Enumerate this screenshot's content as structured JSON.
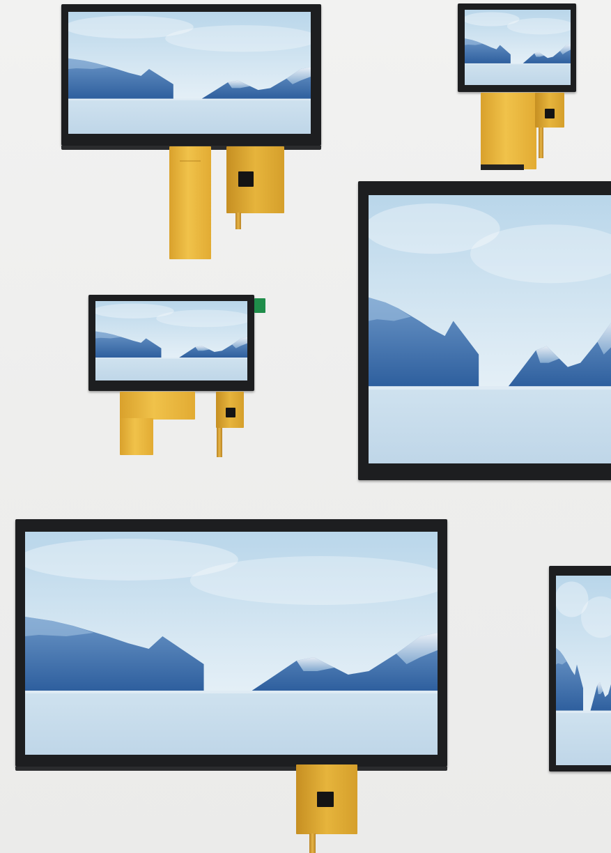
{
  "scene": {
    "subject": "lcd-touch-panels",
    "background_color": "#efefee",
    "bezel_color": "#1d1e20",
    "flex_cable_color": "#e8b53e",
    "sky_color": "#cfe4f2",
    "mountain_color": "#3f72ad",
    "floor_color": "#c9dfee"
  },
  "panels": [
    {
      "name": "panel-top-left",
      "flex_cables": 2
    },
    {
      "name": "panel-top-right-small",
      "flex_cables": 2
    },
    {
      "name": "panel-right-large",
      "flex_cables": 0
    },
    {
      "name": "panel-middle-left",
      "flex_cables": 2
    },
    {
      "name": "panel-bottom-large",
      "flex_cables": 1
    },
    {
      "name": "panel-bottom-right-partial",
      "flex_cables": 0
    }
  ]
}
